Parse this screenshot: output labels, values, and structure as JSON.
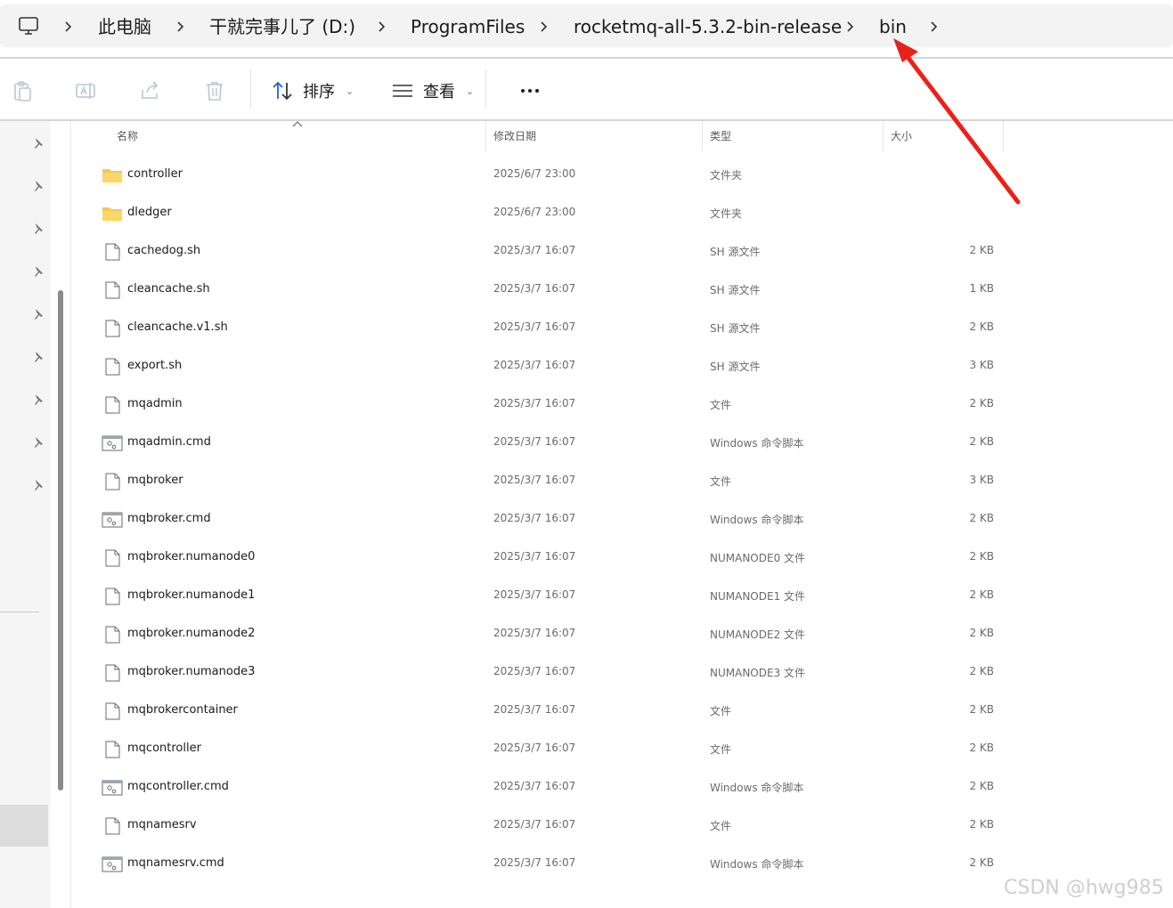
{
  "breadcrumb": {
    "items": [
      "此电脑",
      "干就完事儿了 (D:)",
      "ProgramFiles",
      "rocketmq-all-5.3.2-bin-release",
      "bin"
    ]
  },
  "toolbar": {
    "sort_label": "排序",
    "view_label": "查看",
    "more_icon": "more-horizontal-icon"
  },
  "columns": {
    "name": "名称",
    "modified": "修改日期",
    "type": "类型",
    "size": "大小"
  },
  "files": [
    {
      "name": "controller",
      "date": "2025/6/7 23:00",
      "type": "文件夹",
      "size": "",
      "kind": "folder"
    },
    {
      "name": "dledger",
      "date": "2025/6/7 23:00",
      "type": "文件夹",
      "size": "",
      "kind": "folder"
    },
    {
      "name": "cachedog.sh",
      "date": "2025/3/7 16:07",
      "type": "SH 源文件",
      "size": "2 KB",
      "kind": "file"
    },
    {
      "name": "cleancache.sh",
      "date": "2025/3/7 16:07",
      "type": "SH 源文件",
      "size": "1 KB",
      "kind": "file"
    },
    {
      "name": "cleancache.v1.sh",
      "date": "2025/3/7 16:07",
      "type": "SH 源文件",
      "size": "2 KB",
      "kind": "file"
    },
    {
      "name": "export.sh",
      "date": "2025/3/7 16:07",
      "type": "SH 源文件",
      "size": "3 KB",
      "kind": "file"
    },
    {
      "name": "mqadmin",
      "date": "2025/3/7 16:07",
      "type": "文件",
      "size": "2 KB",
      "kind": "file"
    },
    {
      "name": "mqadmin.cmd",
      "date": "2025/3/7 16:07",
      "type": "Windows 命令脚本",
      "size": "2 KB",
      "kind": "cmd"
    },
    {
      "name": "mqbroker",
      "date": "2025/3/7 16:07",
      "type": "文件",
      "size": "3 KB",
      "kind": "file"
    },
    {
      "name": "mqbroker.cmd",
      "date": "2025/3/7 16:07",
      "type": "Windows 命令脚本",
      "size": "2 KB",
      "kind": "cmd"
    },
    {
      "name": "mqbroker.numanode0",
      "date": "2025/3/7 16:07",
      "type": "NUMANODE0 文件",
      "size": "2 KB",
      "kind": "file"
    },
    {
      "name": "mqbroker.numanode1",
      "date": "2025/3/7 16:07",
      "type": "NUMANODE1 文件",
      "size": "2 KB",
      "kind": "file"
    },
    {
      "name": "mqbroker.numanode2",
      "date": "2025/3/7 16:07",
      "type": "NUMANODE2 文件",
      "size": "2 KB",
      "kind": "file"
    },
    {
      "name": "mqbroker.numanode3",
      "date": "2025/3/7 16:07",
      "type": "NUMANODE3 文件",
      "size": "2 KB",
      "kind": "file"
    },
    {
      "name": "mqbrokercontainer",
      "date": "2025/3/7 16:07",
      "type": "文件",
      "size": "2 KB",
      "kind": "file"
    },
    {
      "name": "mqcontroller",
      "date": "2025/3/7 16:07",
      "type": "文件",
      "size": "2 KB",
      "kind": "file"
    },
    {
      "name": "mqcontroller.cmd",
      "date": "2025/3/7 16:07",
      "type": "Windows 命令脚本",
      "size": "2 KB",
      "kind": "cmd"
    },
    {
      "name": "mqnamesrv",
      "date": "2025/3/7 16:07",
      "type": "文件",
      "size": "2 KB",
      "kind": "file"
    },
    {
      "name": "mqnamesrv.cmd",
      "date": "2025/3/7 16:07",
      "type": "Windows 命令脚本",
      "size": "2 KB",
      "kind": "cmd"
    }
  ],
  "watermark": "CSDN @hwg985",
  "colors": {
    "folder": "#f8c84a",
    "annotation_arrow": "#e8221b",
    "scrollbar": "#8a8a8a"
  }
}
